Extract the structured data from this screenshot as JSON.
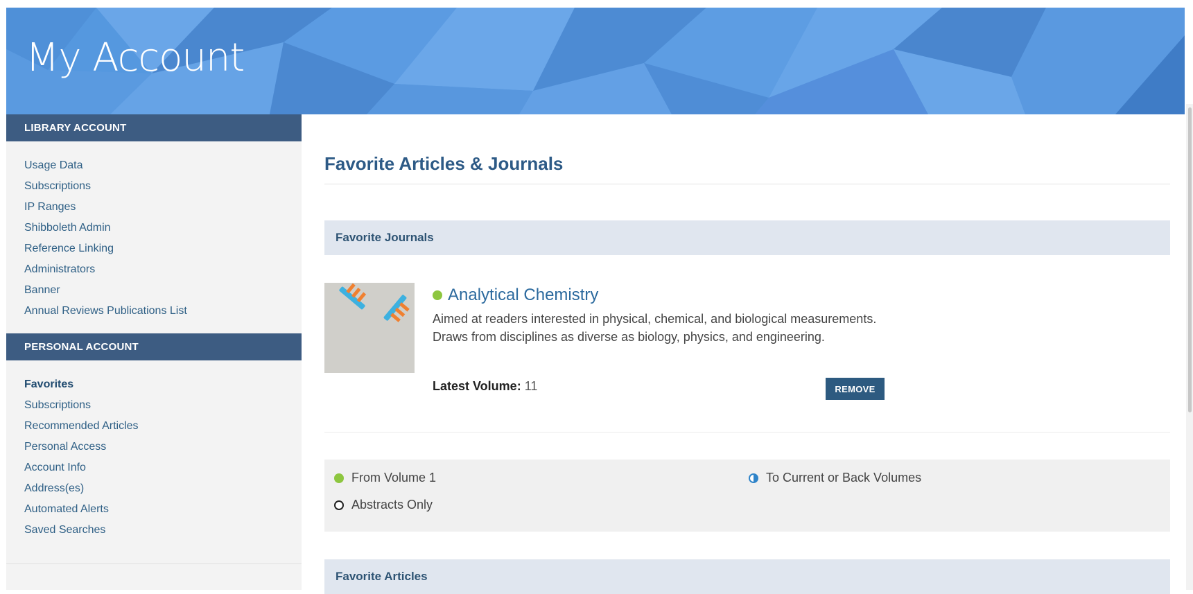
{
  "header": {
    "title": "My Account"
  },
  "sidebar": {
    "library": {
      "heading": "LIBRARY ACCOUNT",
      "items": [
        "Usage Data",
        "Subscriptions",
        "IP Ranges",
        "Shibboleth Admin",
        "Reference Linking",
        "Administrators",
        "Banner",
        "Annual Reviews Publications List"
      ]
    },
    "personal": {
      "heading": "PERSONAL ACCOUNT",
      "items": [
        "Favorites",
        "Subscriptions",
        "Recommended Articles",
        "Personal Access",
        "Account Info",
        "Address(es)",
        "Automated Alerts",
        "Saved Searches"
      ],
      "active": "Favorites"
    }
  },
  "main": {
    "title": "Favorite Articles & Journals",
    "favorite_journals": {
      "heading": "Favorite Journals",
      "journal": {
        "name": "Analytical Chemistry",
        "access": "full",
        "description": "Aimed at readers interested in physical, chemical, and biological measurements. Draws from disciplines as diverse as biology, physics, and engineering.",
        "latest_volume_label": "Latest Volume:",
        "latest_volume_value": "11",
        "remove_label": "REMOVE"
      }
    },
    "legend": {
      "full": "From Volume 1",
      "partial": "To Current or Back Volumes",
      "abstracts": "Abstracts Only"
    },
    "favorite_articles": {
      "heading": "Favorite Articles"
    }
  },
  "colors": {
    "banner": "#5598df",
    "sidebar_heading": "#3d5c82",
    "section_bar": "#e0e6ef",
    "link": "#2e5f85",
    "access_full": "#8dc63f",
    "access_partial": "#2f84c9",
    "button": "#2d5a80"
  }
}
